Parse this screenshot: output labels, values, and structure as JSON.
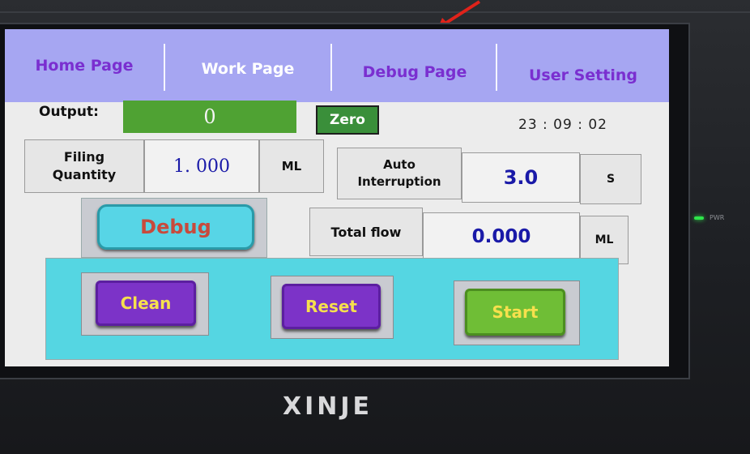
{
  "nav": {
    "home": "Home Page",
    "work": "Work Page",
    "debug": "Debug Page",
    "user": "User Setting"
  },
  "output": {
    "label": "Output:",
    "value": "0",
    "zero_label": "Zero"
  },
  "clock": "23 : 09 : 02",
  "filling": {
    "label_line1": "Filing",
    "label_line2": "Quantity",
    "value": "1. 000",
    "unit": "ML"
  },
  "auto": {
    "label_line1": "Auto",
    "label_line2": "Interruption",
    "value": "3.0",
    "unit": "S"
  },
  "debug_label": "Debug",
  "total_flow": {
    "label": "Total flow",
    "value": "0.000",
    "unit": "ML"
  },
  "buttons": {
    "clean": "Clean",
    "reset": "Reset",
    "start": "Start"
  },
  "brand": "XINJE",
  "pwr": "PWR",
  "colors": {
    "nav_bg": "#a6a6f2",
    "nav_purple_text": "#7a2fd0",
    "nav_active_text": "#ffffff",
    "output_green": "#4fa233",
    "value_blue": "#1a1aa8",
    "debug_text": "#c84a3c",
    "button_purple": "#7c33c8",
    "button_green": "#6fbe36",
    "button_text": "#f6e04d",
    "cyan_zone": "#55d6e2"
  },
  "icons": {
    "annotation": "red-arrow-icon",
    "power_led": "power-led-icon"
  }
}
